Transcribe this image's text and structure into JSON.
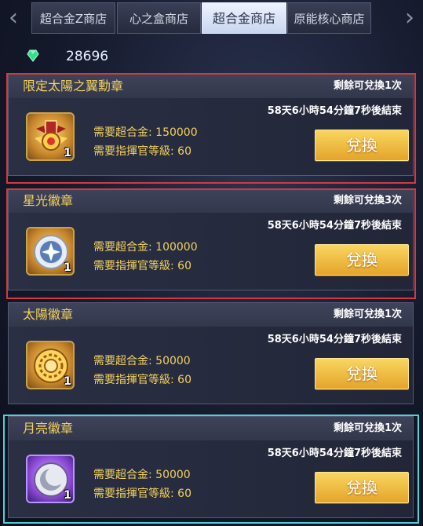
{
  "tabs": [
    {
      "label": "超合金Z商店",
      "active": false
    },
    {
      "label": "心之盒商店",
      "active": false
    },
    {
      "label": "超合金商店",
      "active": true
    },
    {
      "label": "原能核心商店",
      "active": false
    }
  ],
  "currency": {
    "icon": "green-gem-icon",
    "value": "28696"
  },
  "labels": {
    "req_cost": "需要超合金:",
    "req_level": "需要指揮官等級:",
    "button": "兌換"
  },
  "items": [
    {
      "title": "限定太陽之翼勳章",
      "remaining": "剩餘可兌換1次",
      "timer": "58天6小時54分鐘7秒後結束",
      "cost": "150000",
      "level": "60",
      "qty": "1",
      "icon": "sun-wings-medal-icon"
    },
    {
      "title": "星光徽章",
      "remaining": "剩餘可兌換3次",
      "timer": "58天6小時54分鐘7秒後結束",
      "cost": "100000",
      "level": "60",
      "qty": "1",
      "icon": "star-badge-icon"
    },
    {
      "title": "太陽徽章",
      "remaining": "剩餘可兌換1次",
      "timer": "58天6小時54分鐘7秒後結束",
      "cost": "50000",
      "level": "60",
      "qty": "1",
      "icon": "sun-badge-icon"
    },
    {
      "title": "月亮徽章",
      "remaining": "剩餘可兌換1次",
      "timer": "58天6小時54分鐘7秒後結束",
      "cost": "50000",
      "level": "60",
      "qty": "1",
      "icon": "moon-badge-icon"
    }
  ],
  "colors": {
    "gold_text": "#f3d25e",
    "highlight_red": "#d5393f",
    "highlight_cyan": "#4fd1d9",
    "button": "#f0bd45"
  }
}
